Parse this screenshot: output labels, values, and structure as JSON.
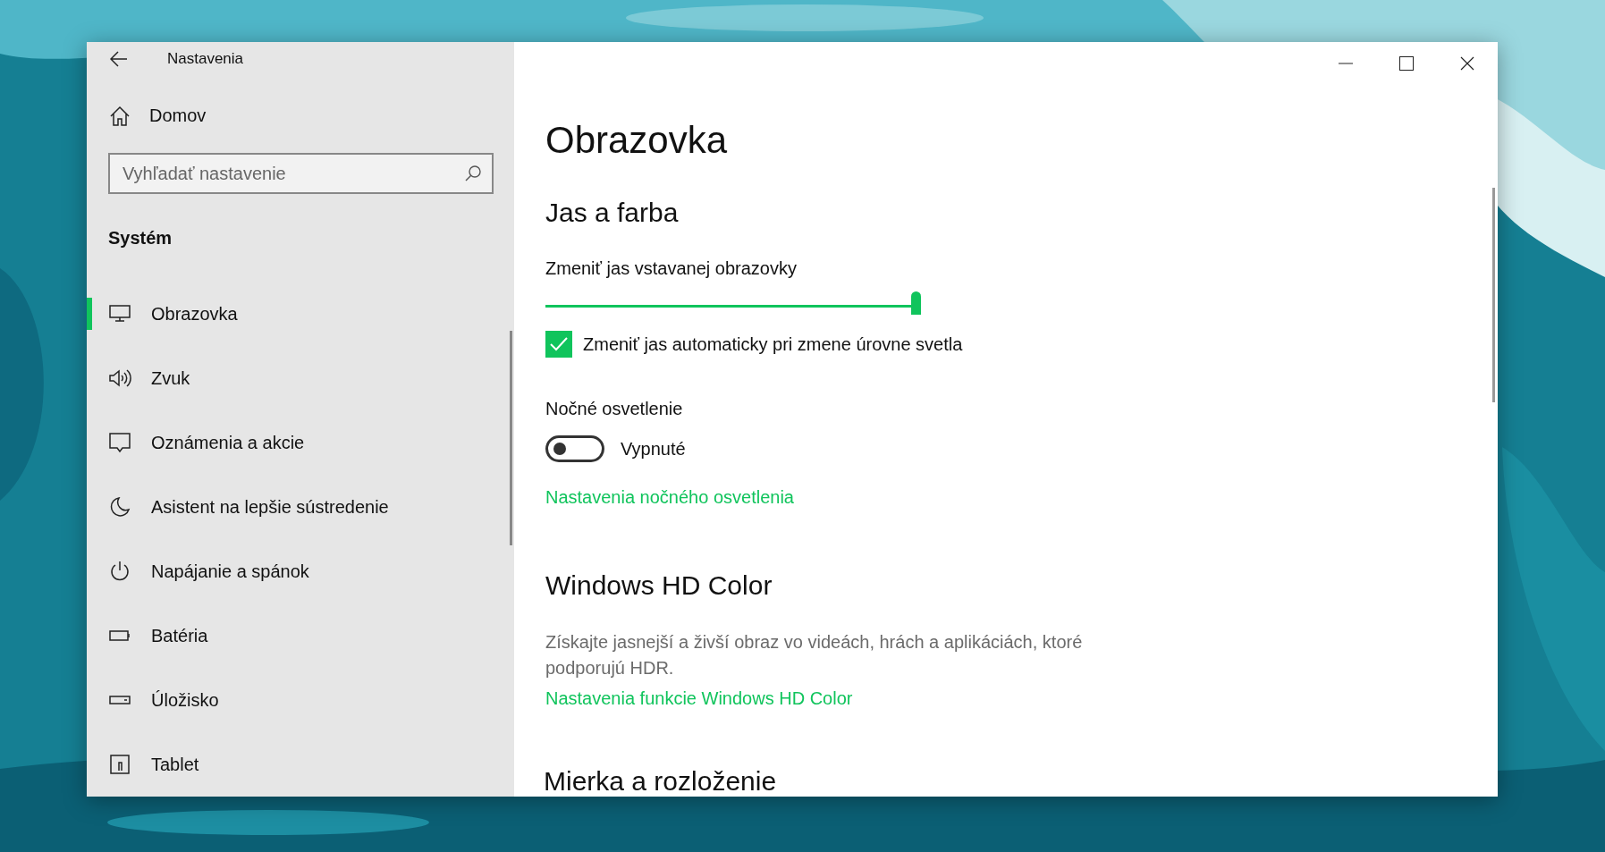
{
  "window": {
    "title": "Nastavenia"
  },
  "sidebar": {
    "home": "Domov",
    "search": {
      "placeholder": "Vyhľadať nastavenie"
    },
    "section": "Systém",
    "items": [
      {
        "label": "Obrazovka",
        "selected": true
      },
      {
        "label": "Zvuk",
        "selected": false
      },
      {
        "label": "Oznámenia a akcie",
        "selected": false
      },
      {
        "label": "Asistent na lepšie sústredenie",
        "selected": false
      },
      {
        "label": "Napájanie a spánok",
        "selected": false
      },
      {
        "label": "Batéria",
        "selected": false
      },
      {
        "label": "Úložisko",
        "selected": false
      },
      {
        "label": "Tablet",
        "selected": false
      }
    ]
  },
  "content": {
    "title": "Obrazovka",
    "brightness": {
      "heading": "Jas a farba",
      "label": "Zmeniť jas vstavanej obrazovky",
      "level": 1.0,
      "auto": {
        "label": "Zmeniť jas automaticky pri zmene úrovne svetla",
        "checked": true
      }
    },
    "night_light": {
      "label": "Nočné osvetlenie",
      "on": false,
      "state": "Vypnuté",
      "link": "Nastavenia nočného osvetlenia"
    },
    "hd_color": {
      "heading": "Windows HD Color",
      "description": "Získajte jasnejší a živší obraz vo videách, hrách a aplikáciách, ktoré podporujú HDR.",
      "link": "Nastavenia funkcie Windows HD Color"
    },
    "next_heading": "Mierka a rozloženie"
  }
}
